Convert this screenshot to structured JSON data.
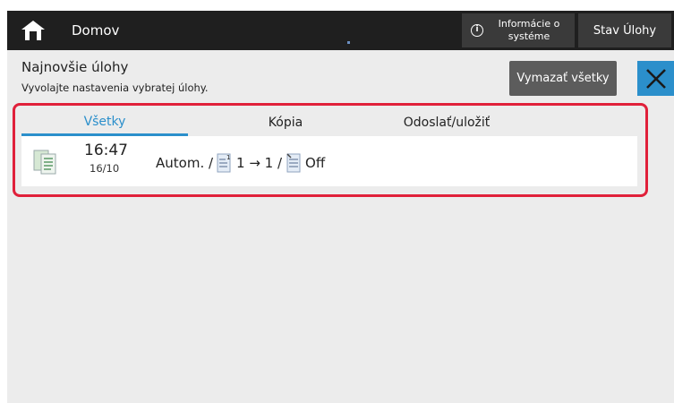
{
  "topbar": {
    "home_icon": "home-icon",
    "title": "Domov",
    "info_icon": "info-icon",
    "info_label": "Informácie o systéme",
    "job_status_label": "Stav Úlohy"
  },
  "header": {
    "title": "Najnovšie úlohy",
    "subtitle": "Vyvolajte nastavenia vybratej úlohy.",
    "clear_all_label": "Vymazať všetky",
    "close_icon": "close-icon"
  },
  "tabs": [
    {
      "label": "Všetky",
      "active": true
    },
    {
      "label": "Kópia",
      "active": false
    },
    {
      "label": "Odoslať/uložiť",
      "active": false
    }
  ],
  "jobs": [
    {
      "icon": "copy-job-icon",
      "time": "16:47",
      "date": "16/10",
      "mode": "Autom. /",
      "duplex_icon": "one-sided-original-icon",
      "duplex": "1 → 1 /",
      "staple_icon": "staple-document-icon",
      "staple": "Off"
    }
  ],
  "colors": {
    "topbar_bg": "#1f1f1f",
    "accent": "#2b8fcb",
    "highlight": "#e0203a",
    "background": "#ececec"
  }
}
